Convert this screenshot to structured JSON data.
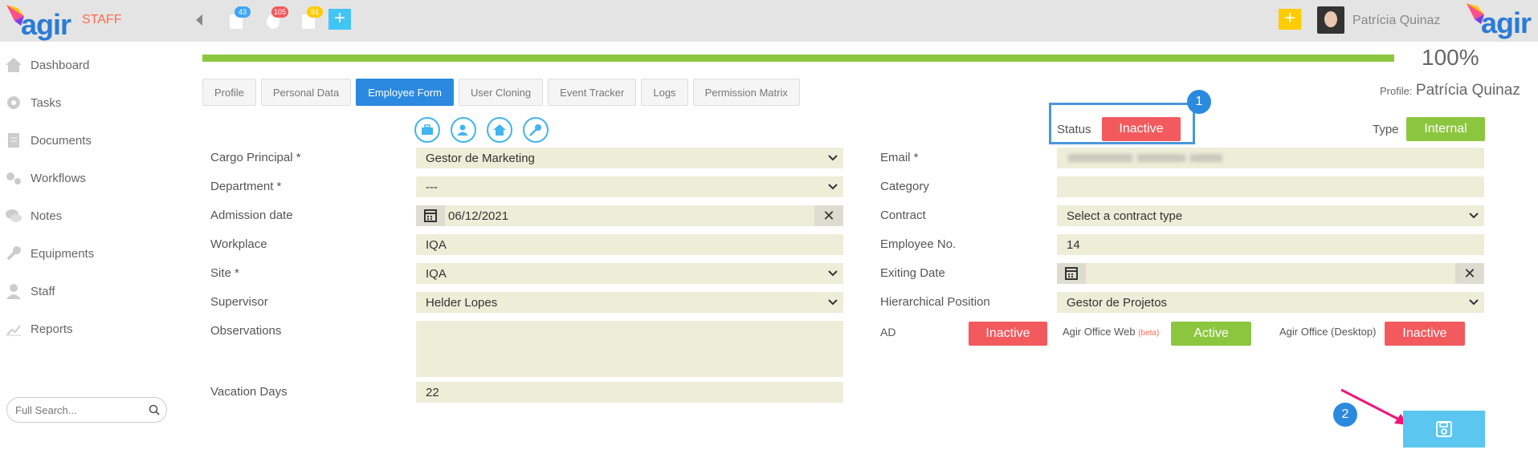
{
  "header": {
    "logo_text": "agir",
    "section": "STAFF",
    "notifications": [
      {
        "name": "calendar",
        "count": "43",
        "color": "#42a5f5"
      },
      {
        "name": "gear",
        "count": "105",
        "color": "#f25a5e"
      },
      {
        "name": "document",
        "count": "91",
        "color": "#ffcc00"
      }
    ],
    "user_name": "Patrícia Quinaz"
  },
  "sidebar": {
    "items": [
      {
        "label": "Dashboard",
        "icon": "home-icon"
      },
      {
        "label": "Tasks",
        "icon": "gear-icon"
      },
      {
        "label": "Documents",
        "icon": "document-icon"
      },
      {
        "label": "Workflows",
        "icon": "gears-icon"
      },
      {
        "label": "Notes",
        "icon": "chat-icon"
      },
      {
        "label": "Equipments",
        "icon": "wrench-icon"
      },
      {
        "label": "Staff",
        "icon": "user-icon"
      },
      {
        "label": "Reports",
        "icon": "chart-icon"
      }
    ],
    "search_placeholder": "Full Search..."
  },
  "progress": {
    "value": 100,
    "label": "100%"
  },
  "tabs": [
    {
      "label": "Profile"
    },
    {
      "label": "Personal Data"
    },
    {
      "label": "Employee Form",
      "active": true
    },
    {
      "label": "User Cloning"
    },
    {
      "label": "Event Tracker"
    },
    {
      "label": "Logs"
    },
    {
      "label": "Permission Matrix"
    }
  ],
  "profile": {
    "label": "Profile:",
    "name": "Patrícia Quinaz"
  },
  "status": {
    "label": "Status",
    "value": "Inactive",
    "marker": "1"
  },
  "type": {
    "label": "Type",
    "value": "Internal"
  },
  "form_left": {
    "cargo_label": "Cargo Principal *",
    "cargo_value": "Gestor de Marketing",
    "department_label": "Department *",
    "department_value": "---",
    "admission_label": "Admission date",
    "admission_value": "06/12/2021",
    "workplace_label": "Workplace",
    "workplace_value": "IQA",
    "site_label": "Site *",
    "site_value": "IQA",
    "supervisor_label": "Supervisor",
    "supervisor_value": "Helder Lopes",
    "observations_label": "Observations",
    "observations_value": "",
    "vacation_label": "Vacation Days",
    "vacation_value": "22"
  },
  "form_right": {
    "email_label": "Email *",
    "category_label": "Category",
    "category_value": "",
    "contract_label": "Contract",
    "contract_value": "Select a contract type",
    "employee_no_label": "Employee No.",
    "employee_no_value": "14",
    "exiting_label": "Exiting Date",
    "exiting_value": "",
    "hier_label": "Hierarchical Position",
    "hier_value": "Gestor de Projetos",
    "ad_label": "AD",
    "ad_value": "Inactive",
    "web_label": "Agir Office Web",
    "web_beta": "(beta)",
    "web_value": "Active",
    "desktop_label": "Agir Office (Desktop)",
    "desktop_value": "Inactive"
  },
  "save": {
    "marker": "2"
  },
  "colors": {
    "accent": "#2b8ae0",
    "inactive": "#f25a5e",
    "active": "#8cc63f",
    "field": "#eeedd8",
    "annotation_arrow": "#f0147a"
  }
}
